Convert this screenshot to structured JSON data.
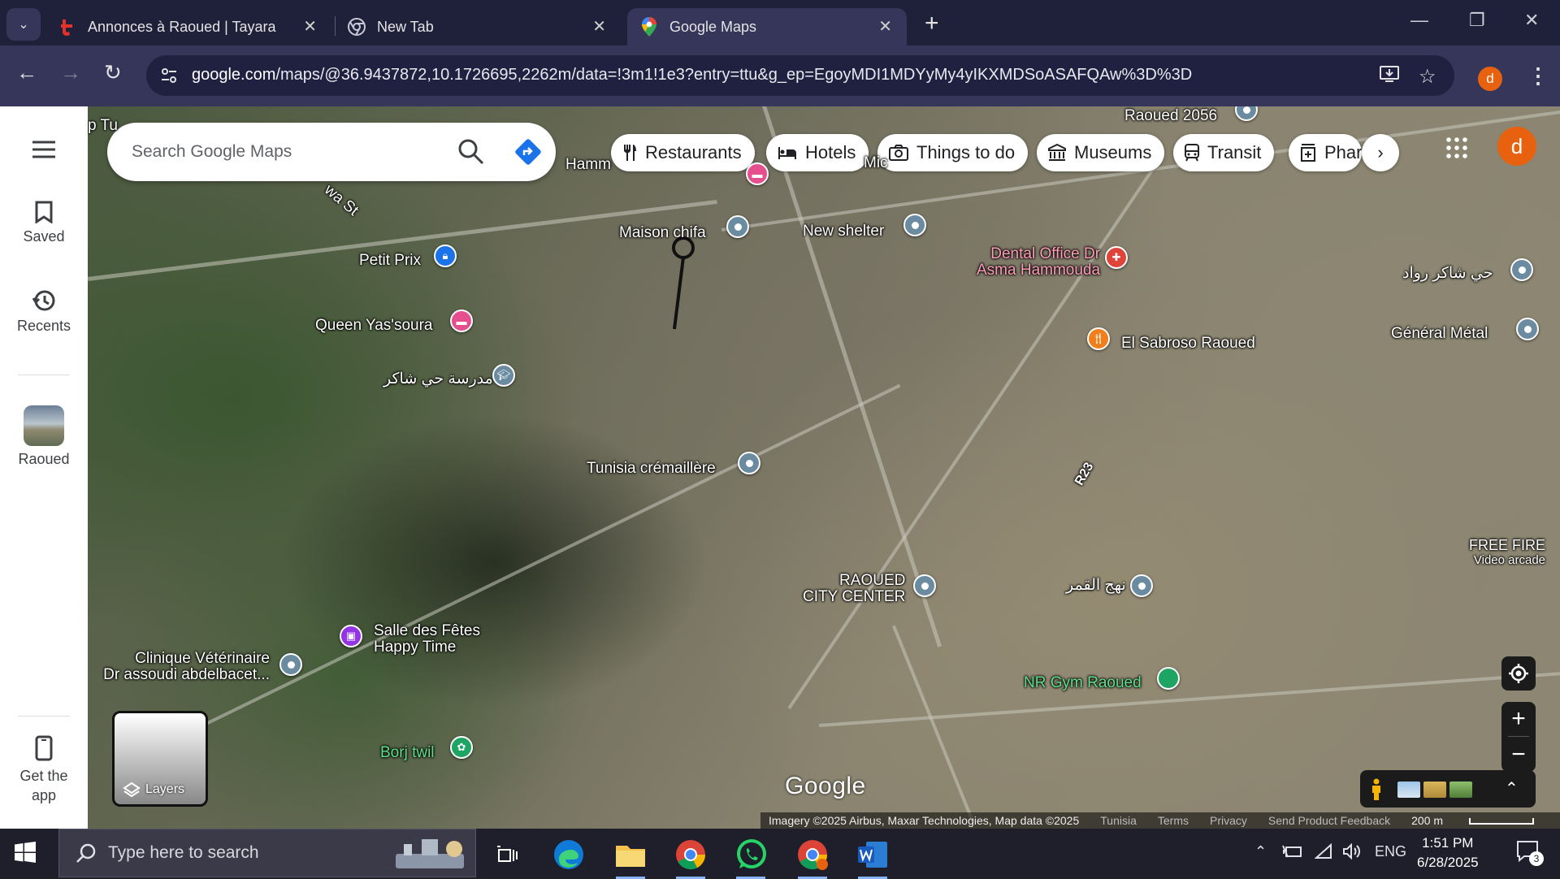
{
  "browser": {
    "tabs": [
      {
        "title": "Annonces à Raoued | Tayara",
        "icon": "tayara-icon",
        "active": false
      },
      {
        "title": "New Tab",
        "icon": "chrome-icon",
        "active": false
      },
      {
        "title": "Google Maps",
        "icon": "google-maps-icon",
        "active": true
      }
    ],
    "url_host": "google.com",
    "url_path": "/maps/@36.9437872,10.1726695,2262m/data=!3m1!1e3?entry=ttu&g_ep=EgoyMDI1MDYyMy4yIKXMDSoASAFQAw%3D%3D",
    "profile_letter": "d",
    "accent": "#e8610f"
  },
  "rail": {
    "saved": "Saved",
    "recents": "Recents",
    "recent_place": "Raoued",
    "get_app": "Get the app"
  },
  "search": {
    "placeholder": "Search Google Maps"
  },
  "chips": [
    "Restaurants",
    "Hotels",
    "Things to do",
    "Museums",
    "Transit",
    "Phar"
  ],
  "account_letter": "d",
  "map": {
    "places": {
      "raoued_2056": "Raoued 2056",
      "maison_chifa": "Maison chifa",
      "new_shelter": "New shelter",
      "dental_line1": "Dental Office Dr",
      "dental_line2": "Asma Hammouda",
      "hay_chaker_rawad": "حي شاكر رواد",
      "petit_prix": "Petit Prix",
      "queen": "Queen Yas'soura",
      "madrasa": "مدرسة حي شاكر",
      "el_sabroso": "El Sabroso Raoued",
      "general_metal": "Général Métal",
      "tunisia_cremaillere": "Tunisia crémaillère",
      "free_fire_line1": "FREE FIRE",
      "free_fire_line2": "Video arcade",
      "raoued_cc_line1": "RAOUED",
      "raoued_cc_line2": "CITY CENTER",
      "nahj_al_qamar": "نهج القمر",
      "salle_line1": "Salle des Fêtes",
      "salle_line2": "Happy Time",
      "clinique_line1": "Clinique Vétérinaire",
      "clinique_line2": "Dr assoudi abdelbacet...",
      "nr_gym": "NR Gym Raoued",
      "borj_twil": "Borj twil",
      "road_r23": "R23",
      "street_wa": "wa St",
      "hamm": "Hamm",
      "top_left": "p Tu",
      "mid_frag": "Mic"
    },
    "layers_label": "Layers",
    "logo": "Google",
    "attribution": {
      "imagery": "Imagery ©2025 Airbus, Maxar Technologies, Map data ©2025",
      "country": "Tunisia",
      "terms": "Terms",
      "privacy": "Privacy",
      "feedback": "Send Product Feedback",
      "scale": "200 m"
    }
  },
  "taskbar": {
    "search_placeholder": "Type here to search",
    "language": "ENG",
    "time": "1:51 PM",
    "date": "6/28/2025",
    "notifications": "3"
  }
}
